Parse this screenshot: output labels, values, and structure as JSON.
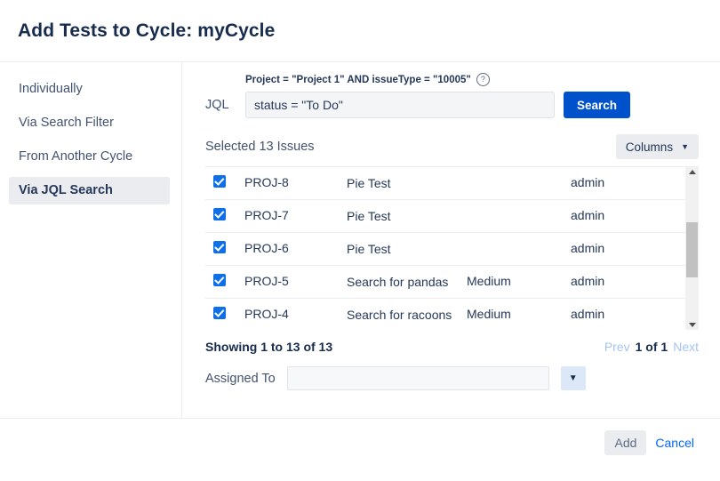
{
  "dialog": {
    "title": "Add Tests to Cycle: myCycle"
  },
  "sidebar": {
    "items": [
      {
        "label": "Individually",
        "selected": false
      },
      {
        "label": "Via Search Filter",
        "selected": false
      },
      {
        "label": "From Another Cycle",
        "selected": false
      },
      {
        "label": "Via JQL Search",
        "selected": true
      }
    ]
  },
  "jql": {
    "hint": "Project = \"Project 1\" AND issueType = \"10005\"",
    "help_icon": "question-circle-icon",
    "label": "JQL",
    "value": "status = \"To Do\"",
    "placeholder": "",
    "search_label": "Search"
  },
  "results": {
    "selected_text": "Selected 13 Issues",
    "columns_label": "Columns",
    "columns_icon": "chevron-down-icon",
    "rows": [
      {
        "checked": true,
        "key": "PROJ-8",
        "summary": "Pie Test",
        "priority": "",
        "assignee": "admin"
      },
      {
        "checked": true,
        "key": "PROJ-7",
        "summary": "Pie Test",
        "priority": "",
        "assignee": "admin"
      },
      {
        "checked": true,
        "key": "PROJ-6",
        "summary": "Pie Test",
        "priority": "",
        "assignee": "admin"
      },
      {
        "checked": true,
        "key": "PROJ-5",
        "summary": "Search for pandas",
        "priority": "Medium",
        "assignee": "admin"
      },
      {
        "checked": true,
        "key": "PROJ-4",
        "summary": "Search for racoons",
        "priority": "Medium",
        "assignee": "admin"
      }
    ]
  },
  "paging": {
    "showing": "Showing 1 to 13 of 13",
    "prev": "Prev",
    "current": "1 of 1",
    "next": "Next"
  },
  "assigned": {
    "label": "Assigned To",
    "value": "",
    "placeholder": "",
    "dropdown_icon": "chevron-down-icon"
  },
  "footer": {
    "add_label": "Add",
    "cancel_label": "Cancel"
  },
  "colors": {
    "accent_blue": "#0052cc",
    "link_blue": "#0065ff",
    "checkbox_blue": "#0f6fe8",
    "title_navy": "#172b4d",
    "muted_grey": "#42526e",
    "chip_grey": "#ebecf0",
    "pager_disabled": "#a5c4f2"
  }
}
